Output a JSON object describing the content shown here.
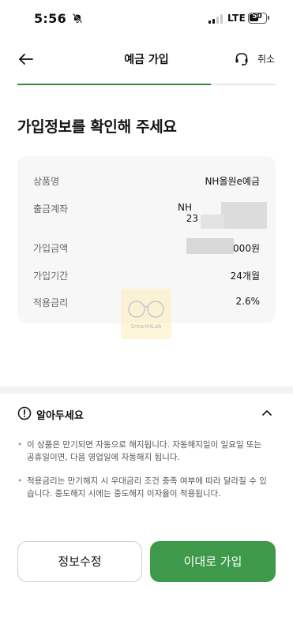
{
  "status_bar": {
    "time": "5:56",
    "network": "LTE",
    "battery": "50"
  },
  "header": {
    "title": "예금 가입",
    "cancel_label": "취소",
    "progress": 0.75
  },
  "page_title": "가입정보를 확인해 주세요",
  "info": {
    "product_label": "상품명",
    "product_value": "NH올원e예금",
    "account_label": "출금계좌",
    "account_value_line1": "NH",
    "account_value_line2": "23",
    "amount_label": "가입금액",
    "amount_value": "000원",
    "period_label": "가입기간",
    "period_value": "24개월",
    "rate_label": "적용금리",
    "rate_value": "2.6%"
  },
  "watermark": {
    "text": "SmartHLab"
  },
  "notice": {
    "title": "알아두세요",
    "items": [
      "이 상품은 만기되면 자동으로 해지됩니다. 자동해지일이 일요일 또는 공휴일이면, 다음 영업일에 자동해지 됩니다.",
      "적용금리는 만기해지 시 우대금리 조건 충족 여부에 따라 달라질 수 있습니다. 중도해지 시에는 중도해지 이자율이 적용됩니다."
    ]
  },
  "buttons": {
    "edit": "정보수정",
    "join": "이대로 가입"
  },
  "colors": {
    "accent": "#3e9a4a",
    "progress": "#2f8a3c",
    "card_bg": "#f7f7f7"
  },
  "icons": [
    "bell-off-icon",
    "back-arrow-icon",
    "headset-icon",
    "info-circle-icon",
    "chevron-up-icon"
  ]
}
